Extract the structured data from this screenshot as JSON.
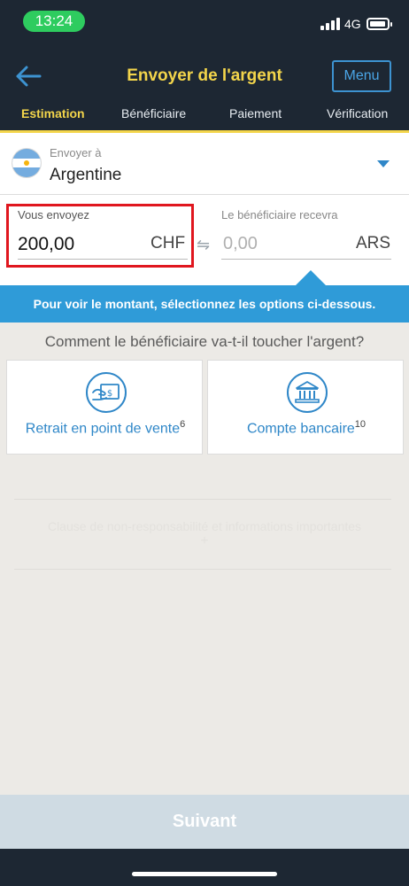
{
  "status_bar": {
    "time": "13:24",
    "network": "4G",
    "icons": [
      "signal-icon",
      "battery-icon"
    ]
  },
  "header": {
    "back_icon": "arrow-left-icon",
    "title": "Envoyer de l'argent",
    "menu_label": "Menu",
    "tabs": [
      {
        "label": "Estimation",
        "active": true
      },
      {
        "label": "Bénéficiaire",
        "active": false
      },
      {
        "label": "Paiement",
        "active": false
      },
      {
        "label": "Vérification",
        "active": false
      }
    ]
  },
  "country": {
    "label": "Envoyer à",
    "value": "Argentine",
    "flag_icon": "argentina-flag-icon"
  },
  "amounts": {
    "send_label": "Vous envoyez",
    "send_value": "200,00",
    "send_currency": "CHF",
    "swap_icon": "⇋",
    "receive_label": "Le bénéficiaire recevra",
    "receive_value": "0,00",
    "receive_currency": "ARS"
  },
  "info_banner": "Pour voir le montant, sélectionnez les options ci-dessous.",
  "question": "Comment le bénéficiaire va-t-il toucher l'argent?",
  "options": [
    {
      "label": "Retrait en point de vente",
      "footnote": "6",
      "icon": "cash-pickup-icon"
    },
    {
      "label": "Compte bancaire",
      "footnote": "10",
      "icon": "bank-icon"
    }
  ],
  "disclaimer": {
    "text": "Clause de non-responsabilité et informations importantes",
    "expand": "+"
  },
  "next_button": "Suivant",
  "colors": {
    "header_bg": "#1d2733",
    "accent_yellow": "#f3d54b",
    "accent_blue": "#2f87c8",
    "banner_blue": "#2f9bd8",
    "highlight_red": "#e0161e",
    "time_pill_green": "#2ecc5f"
  }
}
